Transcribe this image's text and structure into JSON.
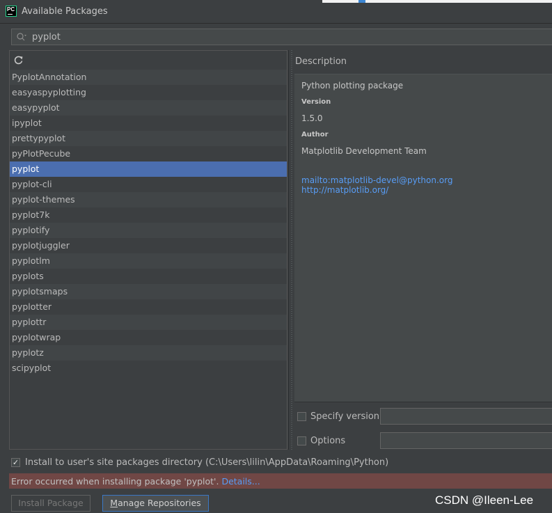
{
  "window": {
    "title": "Available Packages",
    "app_icon_text": "PC"
  },
  "search": {
    "value": "pyplot",
    "icon": "search-icon"
  },
  "packages": [
    "PyplotAnnotation",
    "easyaspyplotting",
    "easypyplot",
    "ipyplot",
    "prettypyplot",
    "pyPlotPecube",
    "pyplot",
    "pyplot-cli",
    "pyplot-themes",
    "pyplot7k",
    "pyplotify",
    "pyplotjuggler",
    "pyplotlm",
    "pyplots",
    "pyplotsmaps",
    "pyplotter",
    "pyplottr",
    "pyplotwrap",
    "pyplotz",
    "scipyplot"
  ],
  "selected_package": "pyplot",
  "description": {
    "label": "Description",
    "summary": "Python plotting package",
    "version_heading": "Version",
    "version": "1.5.0",
    "author_heading": "Author",
    "author": "Matplotlib Development Team",
    "links": [
      "mailto:matplotlib-devel@python.org",
      "http://matplotlib.org/"
    ]
  },
  "options": {
    "specify_version_label": "Specify version",
    "specify_version_value": "",
    "options_label": "Options",
    "options_value": ""
  },
  "install_user": {
    "label": "Install to user's site packages directory (C:\\Users\\lilin\\AppData\\Roaming\\Python)",
    "checked": true
  },
  "error": {
    "message": "Error occurred when installing package 'pyplot'. ",
    "details_link": "Details..."
  },
  "buttons": {
    "install_label": "Install Package",
    "manage_label_first": "M",
    "manage_label_rest": "anage Repositories"
  },
  "watermark": "CSDN @Ileen-Lee",
  "colors": {
    "selection": "#4b6eaf",
    "link": "#589df6",
    "error_bar": "#704745",
    "focus_border": "#3b78c5"
  }
}
